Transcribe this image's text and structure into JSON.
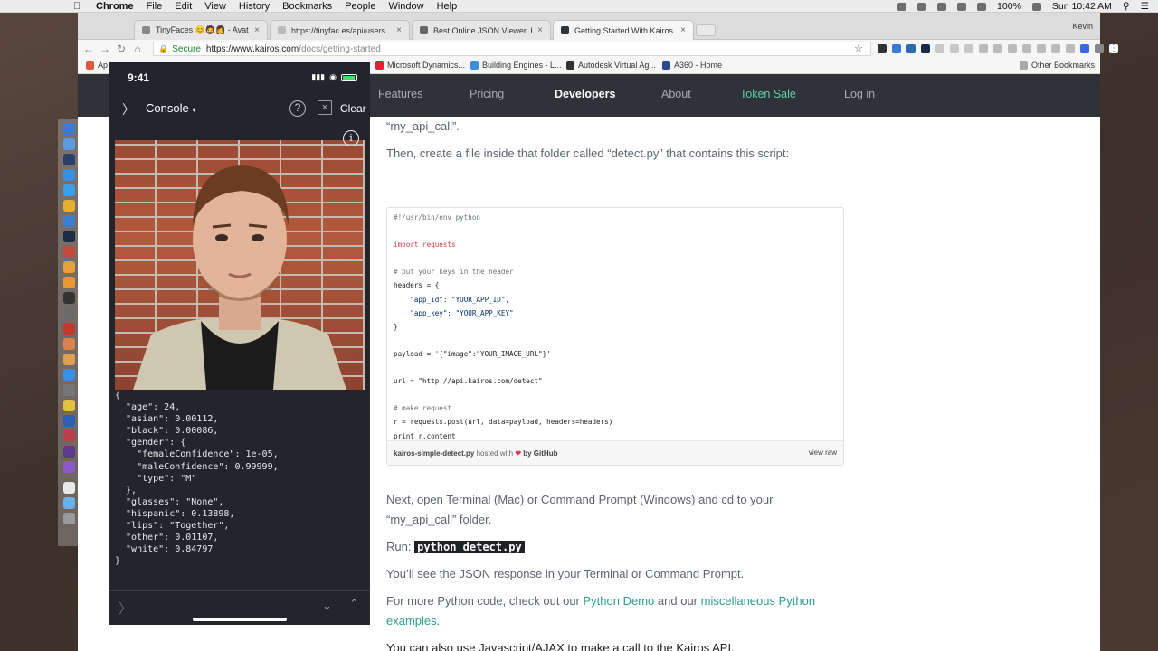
{
  "menubar": {
    "app": "Chrome",
    "items": [
      "File",
      "Edit",
      "View",
      "History",
      "Bookmarks",
      "People",
      "Window",
      "Help"
    ],
    "battery": "100%",
    "clock": "Sun 10:42 AM"
  },
  "browser": {
    "tabs": [
      {
        "title": "TinyFaces 😊🧔👩 - Avatars"
      },
      {
        "title": "https://tinyfac.es/api/users"
      },
      {
        "title": "Best Online JSON Viewer, Bea"
      },
      {
        "title": "Getting Started With Kairos Fa"
      }
    ],
    "profile": "Kevin",
    "url_secure": "Secure",
    "url_host": "https://www.kairos.com",
    "url_path": "/docs/getting-started",
    "bookmarks": [
      "Ap",
      "Microsoft Dynamics...",
      "Building Engines - L...",
      "Autodesk Virtual Ag...",
      "A360 - Home",
      "Other Bookmarks"
    ]
  },
  "site_nav": {
    "items": [
      "Features",
      "Pricing",
      "Developers",
      "About",
      "Token Sale",
      "Log in"
    ]
  },
  "doc": {
    "line1": "“my_api_call”.",
    "line2": "Then, create a file inside that folder called “detect.py” that contains this script:",
    "gist_filename": "kairos-simple-detect.py",
    "gist_hosted": "hosted with",
    "gist_by": "by GitHub",
    "gist_view_raw": "view raw",
    "code": [
      "#!/usr/bin/env python",
      "",
      "import requests",
      "",
      "# put your keys in the header",
      "headers = {",
      "    \"app_id\": \"YOUR_APP_ID\",",
      "    \"app_key\": \"YOUR_APP_KEY\"",
      "}",
      "",
      "payload = '{\"image\":\"YOUR_IMAGE_URL\"}'",
      "",
      "url = \"http://api.kairos.com/detect\"",
      "",
      "# make request",
      "r = requests.post(url, data=payload, headers=headers)",
      "print r.content"
    ],
    "next1": "Next, open Terminal (Mac) or Command Prompt (Windows) and cd to your",
    "next2": "“my_api_call” folder.",
    "run_label": "Run:",
    "run_cmd": "python detect.py",
    "see": "You’ll see the JSON response in your Terminal or Command Prompt.",
    "more1": "For more Python code, check out our",
    "more_link1": "Python Demo",
    "more2": "and our",
    "more_link2": "miscellaneous Python",
    "more_link3": "examples",
    "more_end": ".",
    "js": "You can also use Javascript/AJAX to make a call to the Kairos API."
  },
  "phone": {
    "time": "9:41",
    "console_title": "Console",
    "clear": "Clear",
    "json_output": "{\n  \"age\": 24,\n  \"asian\": 0.00112,\n  \"black\": 0.00086,\n  \"gender\": {\n    \"femaleConfidence\": 1e-05,\n    \"maleConfidence\": 0.99999,\n    \"type\": \"M\"\n  },\n  \"glasses\": \"None\",\n  \"hispanic\": 0.13898,\n  \"lips\": \"Together\",\n  \"other\": 0.01107,\n  \"white\": 0.84797\n}"
  },
  "colors": {
    "nav_bg": "#2f3338",
    "accent": "#2a9d8f",
    "token_sale": "#5fcfa8",
    "console_bg": "#22262c"
  }
}
